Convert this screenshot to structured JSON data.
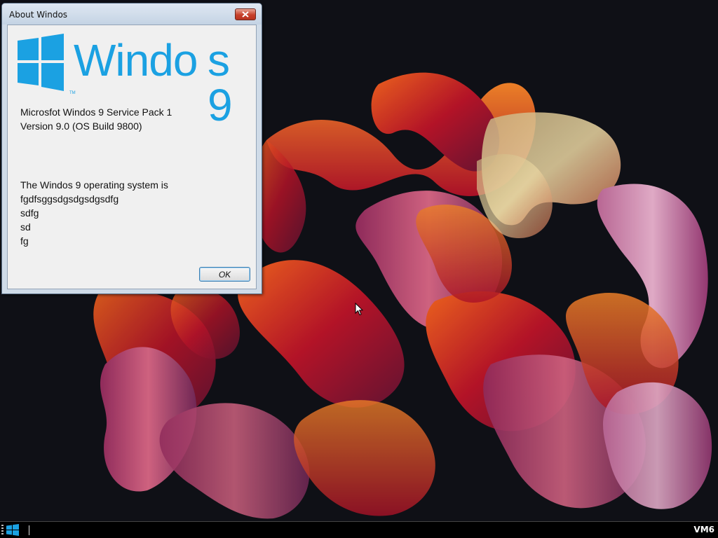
{
  "window": {
    "title": "About Windos",
    "close_icon": "close-icon"
  },
  "logo": {
    "icon": "windows-logo-icon",
    "brand_main": "Windo",
    "brand_suffix": "s 9",
    "trademark": "TM",
    "color": "#1ba1e2"
  },
  "info": {
    "product_line": "Microsfot Windos 9 Service Pack 1",
    "version_line": "Version 9.0 (OS Build 9800)",
    "description_lines": [
      "The Windos 9 operating system is",
      "fgdfsggsdgsdgsdgsdfg",
      "sdfg",
      "sd",
      "fg"
    ]
  },
  "buttons": {
    "ok_label": "OK"
  },
  "taskbar": {
    "start_icon": "windows-logo-icon",
    "vm_label": "VM6"
  }
}
